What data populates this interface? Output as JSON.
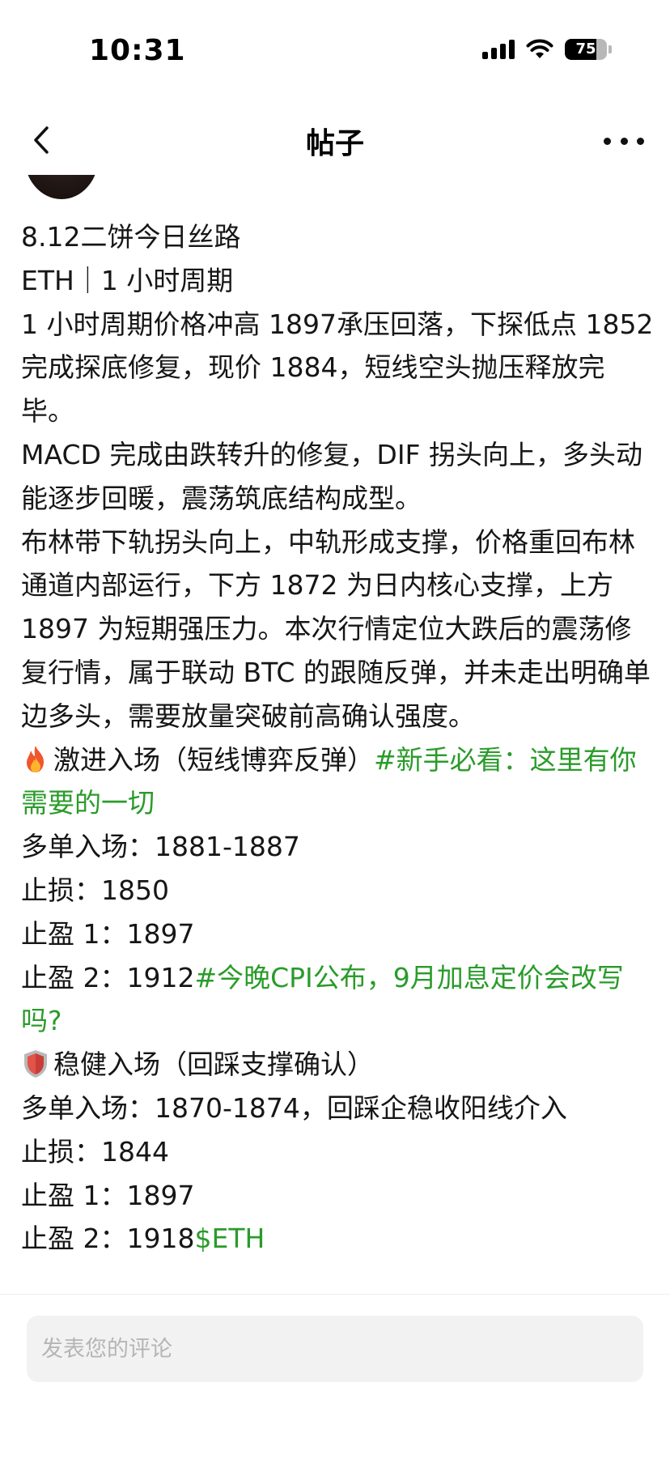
{
  "status_bar": {
    "time": "10:31",
    "battery": "75",
    "battery_level": 0.75,
    "icons": [
      "cellular-signal-icon",
      "wifi-icon",
      "battery-icon"
    ]
  },
  "nav": {
    "back_icon": "chevron-left-icon",
    "title": "帖子",
    "more_icon": "more-horizontal-icon"
  },
  "post": {
    "title": "8.12二饼今日丝路",
    "line2": "ETH｜1 小时周期",
    "para1": "1 小时周期价格冲高 1897承压回落，下探低点 1852 完成探底修复，现价 1884，短线空头抛压释放完毕。",
    "para2": "MACD 完成由跌转升的修复，DIF 拐头向上，多头动能逐步回暖，震荡筑底结构成型。",
    "para3": "布林带下轨拐头向上，中轨形成支撑，价格重回布林通道内部运行，下方 1872 为日内核心支撑，上方 1897 为短期强压力。本次行情定位大跌后的震荡修复行情，属于联动 BTC 的跟随反弹，并未走出明确单边多头，需要放量突破前高确认强度。",
    "aggressive": {
      "icon": "fire-icon",
      "heading": "激进入场（短线博弈反弹）",
      "topic1": "#新手必看：这里有你需要的一切",
      "entry": "多单入场：1881-1887",
      "stop": "止损：1850",
      "tp1": "止盈 1：1897",
      "tp2": "止盈 2：1912",
      "topic2": "#今晚CPI公布，9月加息定价会改写吗?"
    },
    "steady": {
      "icon": "shield-icon",
      "heading": "稳健入场（回踩支撑确认）",
      "entry": "多单入场：1870-1874，回踩企稳收阳线介入",
      "stop": "止损：1844",
      "tp1": "止盈 1：1897",
      "tp2": "止盈 2：1918",
      "cashtag": "$ETH"
    }
  },
  "comment": {
    "placeholder": "发表您的评论"
  },
  "colors": {
    "link": "#2a9b2a",
    "text": "#161616",
    "input_bg": "#f2f2f2"
  }
}
